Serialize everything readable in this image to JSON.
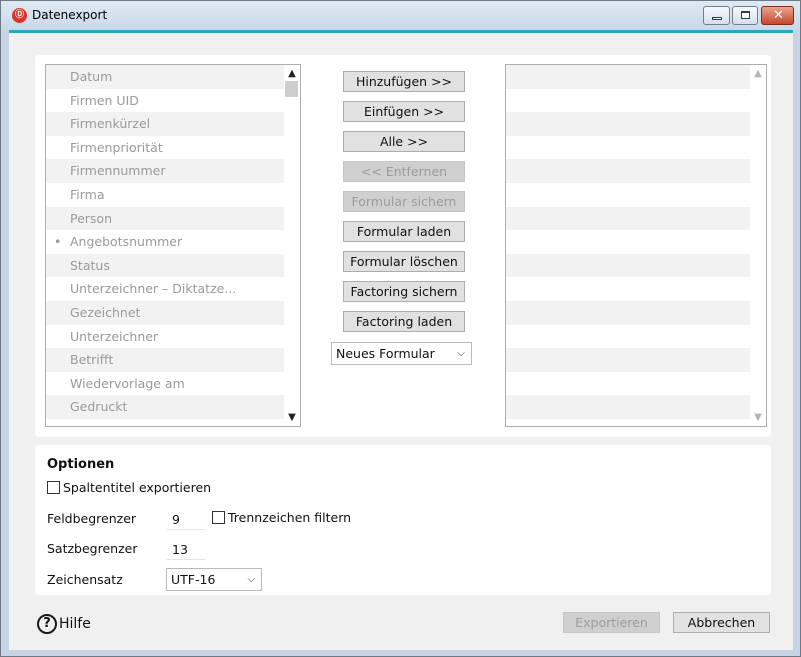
{
  "window": {
    "title": "Datenexport",
    "app_icon": "app-logo-icon",
    "controls": [
      "minimize-icon",
      "maximize-icon",
      "close-icon"
    ]
  },
  "available_fields": [
    {
      "label": "Datum",
      "selected": false
    },
    {
      "label": "Firmen UID",
      "selected": false
    },
    {
      "label": "Firmenkürzel",
      "selected": false
    },
    {
      "label": "Firmenpriorität",
      "selected": false
    },
    {
      "label": "Firmennummer",
      "selected": false
    },
    {
      "label": "Firma",
      "selected": false
    },
    {
      "label": "Person",
      "selected": false
    },
    {
      "label": "Angebotsnummer",
      "selected": true
    },
    {
      "label": "Status",
      "selected": false
    },
    {
      "label": "Unterzeichner – Diktatze...",
      "selected": false
    },
    {
      "label": "Gezeichnet",
      "selected": false
    },
    {
      "label": "Unterzeichner",
      "selected": false
    },
    {
      "label": "Betrifft",
      "selected": false
    },
    {
      "label": "Wiedervorlage am",
      "selected": false
    },
    {
      "label": "Gedruckt",
      "selected": false
    }
  ],
  "buttons": {
    "add": "Hinzufügen >>",
    "insert": "Einfügen >>",
    "all": "Alle >>",
    "remove": "<< Entfernen",
    "save_form": "Formular sichern",
    "load_form": "Formular laden",
    "delete_form": "Formular löschen",
    "save_factoring": "Factoring sichern",
    "load_factoring": "Factoring laden",
    "export": "Exportieren",
    "cancel": "Abbrechen"
  },
  "form_select": {
    "value": "Neues Formular"
  },
  "options": {
    "title": "Optionen",
    "column_titles_label": "Spaltentitel exportieren",
    "column_titles_checked": false,
    "field_delimiter_label": "Feldbegrenzer",
    "field_delimiter_value": "9",
    "filter_separator_label": "Trennzeichen filtern",
    "filter_separator_checked": false,
    "record_delimiter_label": "Satzbegrenzer",
    "record_delimiter_value": "13",
    "charset_label": "Zeichensatz",
    "charset_value": "UTF-16"
  },
  "help": {
    "label": "Hilfe",
    "icon": "help-circle-icon"
  },
  "colors": {
    "accent": "#2aa7b8",
    "close_button": "#c6472f"
  }
}
